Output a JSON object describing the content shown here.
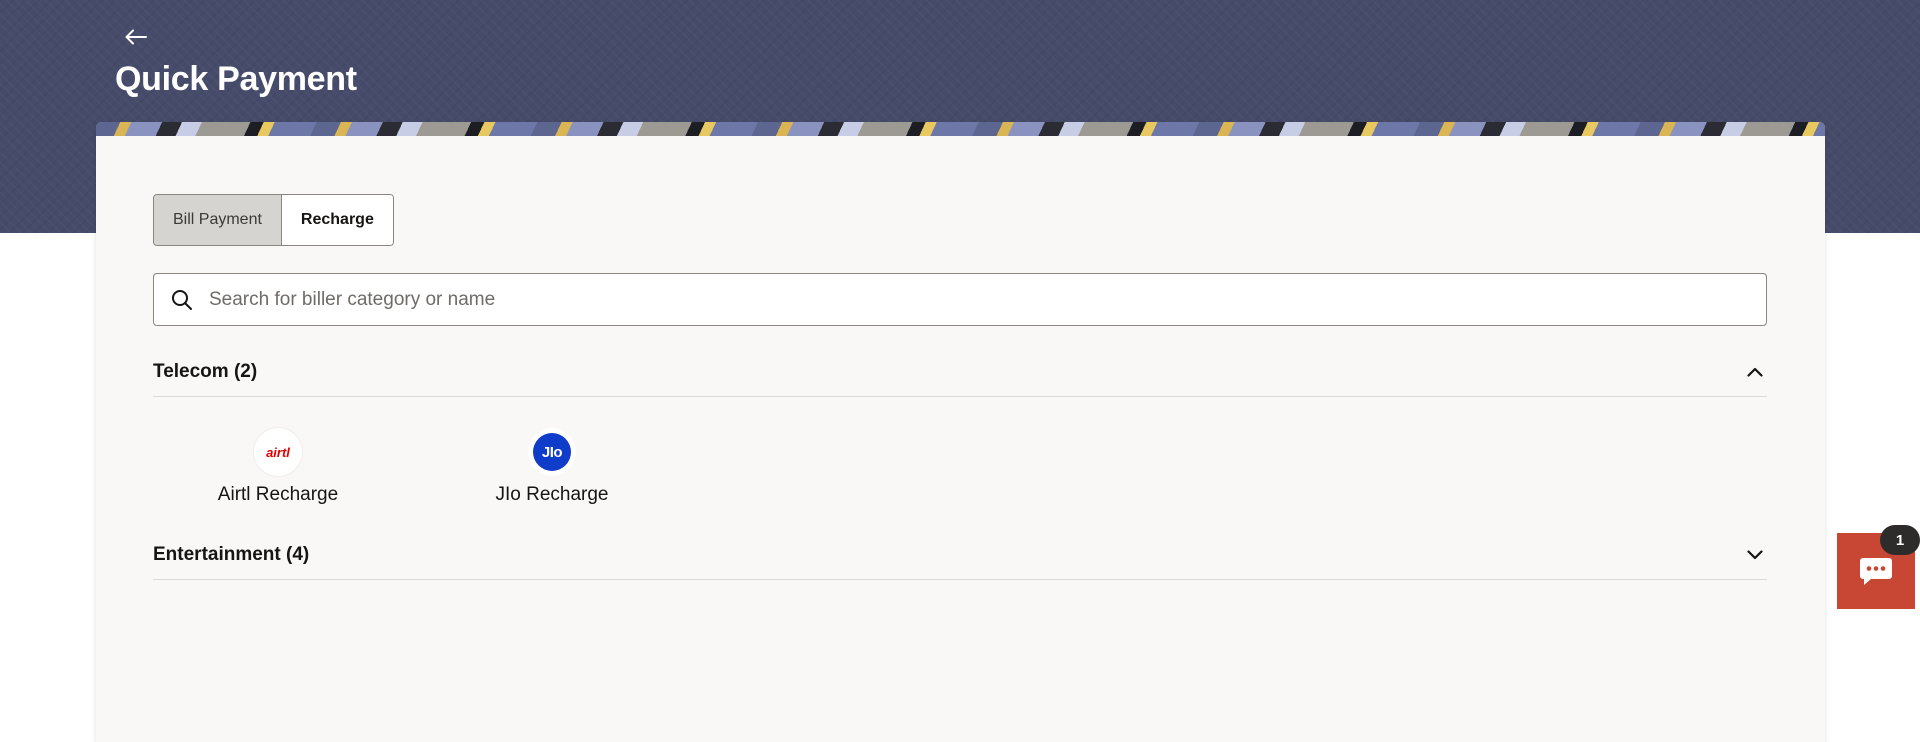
{
  "header": {
    "title": "Quick Payment",
    "back_icon": "arrow-left-icon"
  },
  "toggle": {
    "options": [
      {
        "label": "Bill Payment",
        "active": true
      },
      {
        "label": "Recharge",
        "active": false
      }
    ]
  },
  "search": {
    "placeholder": "Search for biller category or name",
    "value": "",
    "icon": "search-icon"
  },
  "categories": [
    {
      "title": "Telecom (2)",
      "expanded": true,
      "chevron": "chevron-up-icon",
      "billers": [
        {
          "name": "Airtl Recharge",
          "logo_text": "airtl",
          "logo_color": "#e40000"
        },
        {
          "name": "JIo Recharge",
          "logo_text": "JIo",
          "logo_color": "#0f3cc9"
        }
      ]
    },
    {
      "title": "Entertainment (4)",
      "expanded": false,
      "chevron": "chevron-down-icon",
      "billers": []
    }
  ],
  "chat": {
    "icon": "chat-bubble-icon",
    "badge_count": "1",
    "color": "#c74634"
  },
  "colors": {
    "header_bg": "#464b6a",
    "card_bg": "#faf8f6",
    "accent": "#c74634"
  }
}
